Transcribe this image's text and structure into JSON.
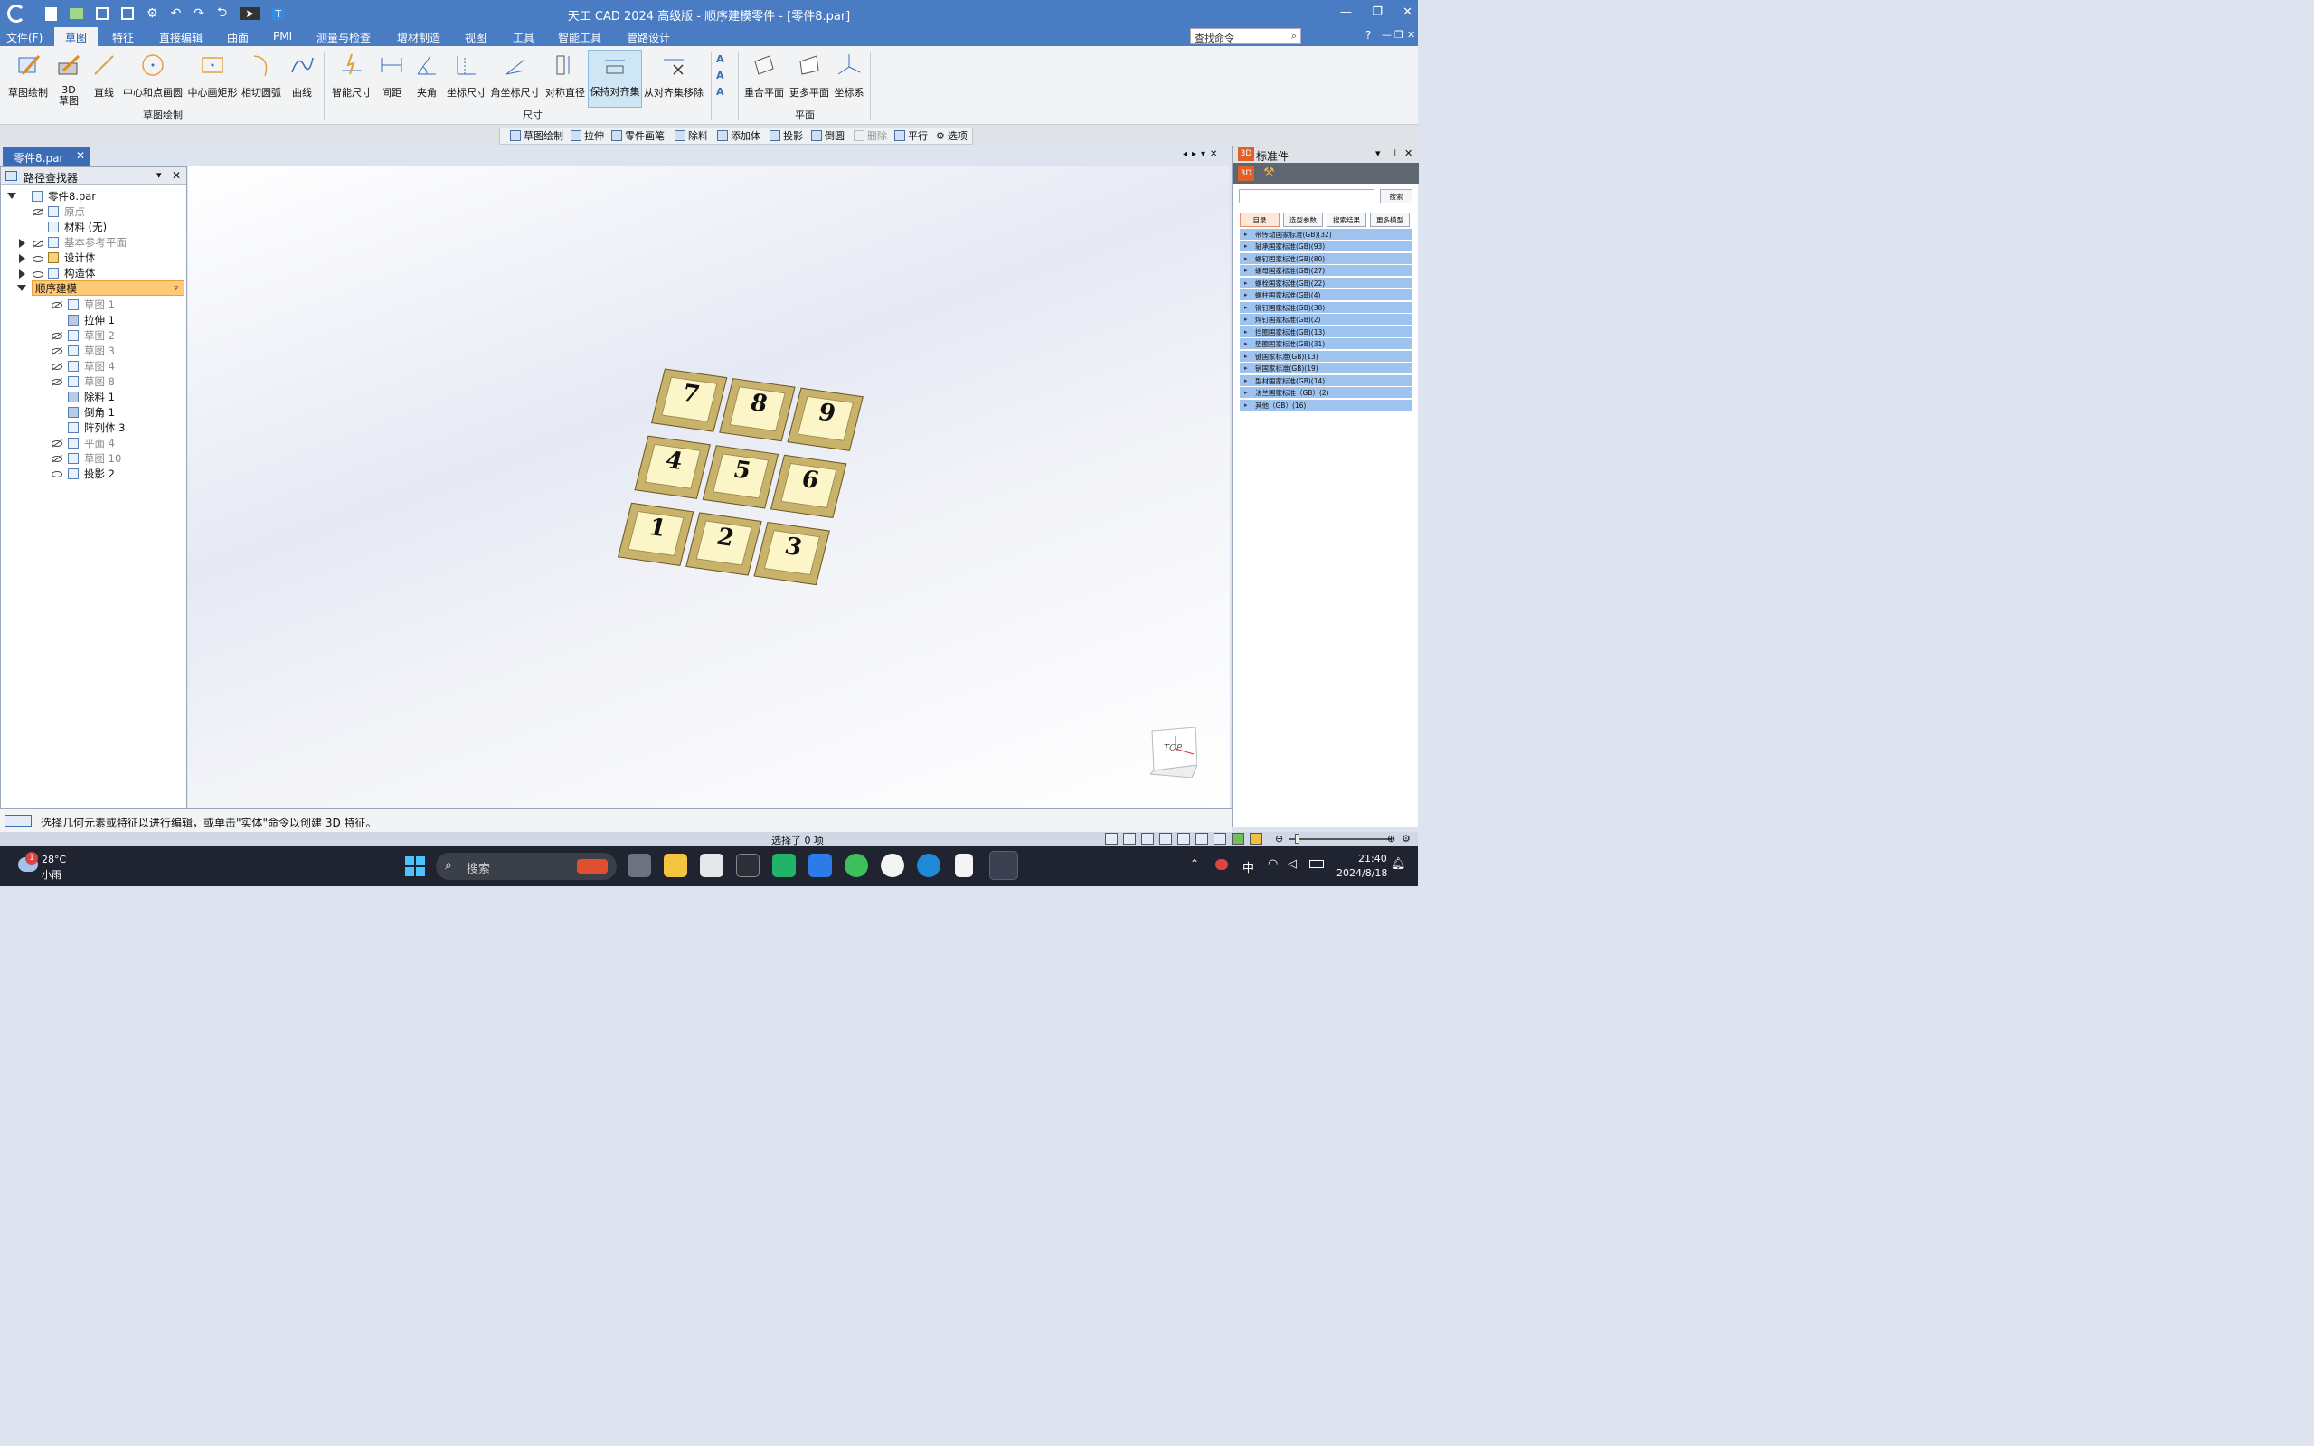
{
  "window": {
    "title": "天工 CAD 2024 高级版 - 顺序建模零件 - [零件8.par]"
  },
  "menu": [
    "文件(F)",
    "草图",
    "特征",
    "直接编辑",
    "曲面",
    "PMI",
    "测量与检查",
    "增材制造",
    "视图",
    "工具",
    "智能工具",
    "管路设计"
  ],
  "search_command": {
    "placeholder": "查找命令"
  },
  "ribbon": {
    "sketch": [
      "草图绘制",
      "3D\n草图",
      "直线",
      "中心和点画圆",
      "中心画矩形",
      "相切圆弧",
      "曲线"
    ],
    "sketch_group": "草图绘制",
    "dim": [
      "智能尺寸",
      "间距",
      "夹角",
      "坐标尺寸",
      "角坐标尺寸",
      "对称直径",
      "保持对齐集",
      "从对齐集移除"
    ],
    "dim_group": "尺寸",
    "plane": [
      "重合平面",
      "更多平面",
      "坐标系"
    ],
    "plane_group": "平面"
  },
  "commandbar": [
    "草图绘制",
    "拉伸",
    "零件画笔",
    "除料",
    "添加体",
    "投影",
    "倒圆",
    "删除",
    "平行",
    "选项"
  ],
  "doc_tab": "零件8.par",
  "pathfinder": {
    "title": "路径查找器",
    "items": [
      {
        "label": "零件8.par"
      },
      {
        "label": "原点"
      },
      {
        "label": "材料 (无)"
      },
      {
        "label": "基本参考平面"
      },
      {
        "label": "设计体"
      },
      {
        "label": "构造体"
      },
      {
        "label": "顺序建模"
      },
      {
        "label": "草图 1"
      },
      {
        "label": "拉伸 1"
      },
      {
        "label": "草图 2"
      },
      {
        "label": "草图 3"
      },
      {
        "label": "草图 4"
      },
      {
        "label": "草图 8"
      },
      {
        "label": "除料 1"
      },
      {
        "label": "倒角 1"
      },
      {
        "label": "阵列体 3"
      },
      {
        "label": "平面 4"
      },
      {
        "label": "草图 10"
      },
      {
        "label": "投影 2"
      }
    ]
  },
  "keypad": [
    "7",
    "8",
    "9",
    "4",
    "5",
    "6",
    "1",
    "2",
    "3"
  ],
  "view_cube": "TOP",
  "library": {
    "title": "标准件",
    "search_button": "搜索",
    "tabs": [
      "目录",
      "选型参数",
      "搜索结果",
      "更多模型"
    ],
    "items": [
      "带传动国家标准(GB)(32)",
      "轴承国家标准(GB)(93)",
      "螺钉国家标准(GB)(80)",
      "螺母国家标准(GB)(27)",
      "螺栓国家标准(GB)(22)",
      "螺柱国家标准(GB)(4)",
      "铆钉国家标准(GB)(38)",
      "焊钉国家标准(GB)(2)",
      "挡圈国家标准(GB)(13)",
      "垫圈国家标准(GB)(31)",
      "键国家标准(GB)(13)",
      "销国家标准(GB)(19)",
      "型材国家标准(GB)(14)",
      "法兰国家标准（GB）(2)",
      "其他（GB）(16)"
    ]
  },
  "status": {
    "prompt": "选择几何元素或特征以进行编辑，或单击\"实体\"命令以创建 3D 特征。",
    "selection": "选择了 0 项"
  },
  "taskbar": {
    "temp": "28°C",
    "weather": "小雨",
    "badge": "1",
    "search": "搜索",
    "ime": "中",
    "time": "21:40",
    "date": "2024/8/18"
  }
}
